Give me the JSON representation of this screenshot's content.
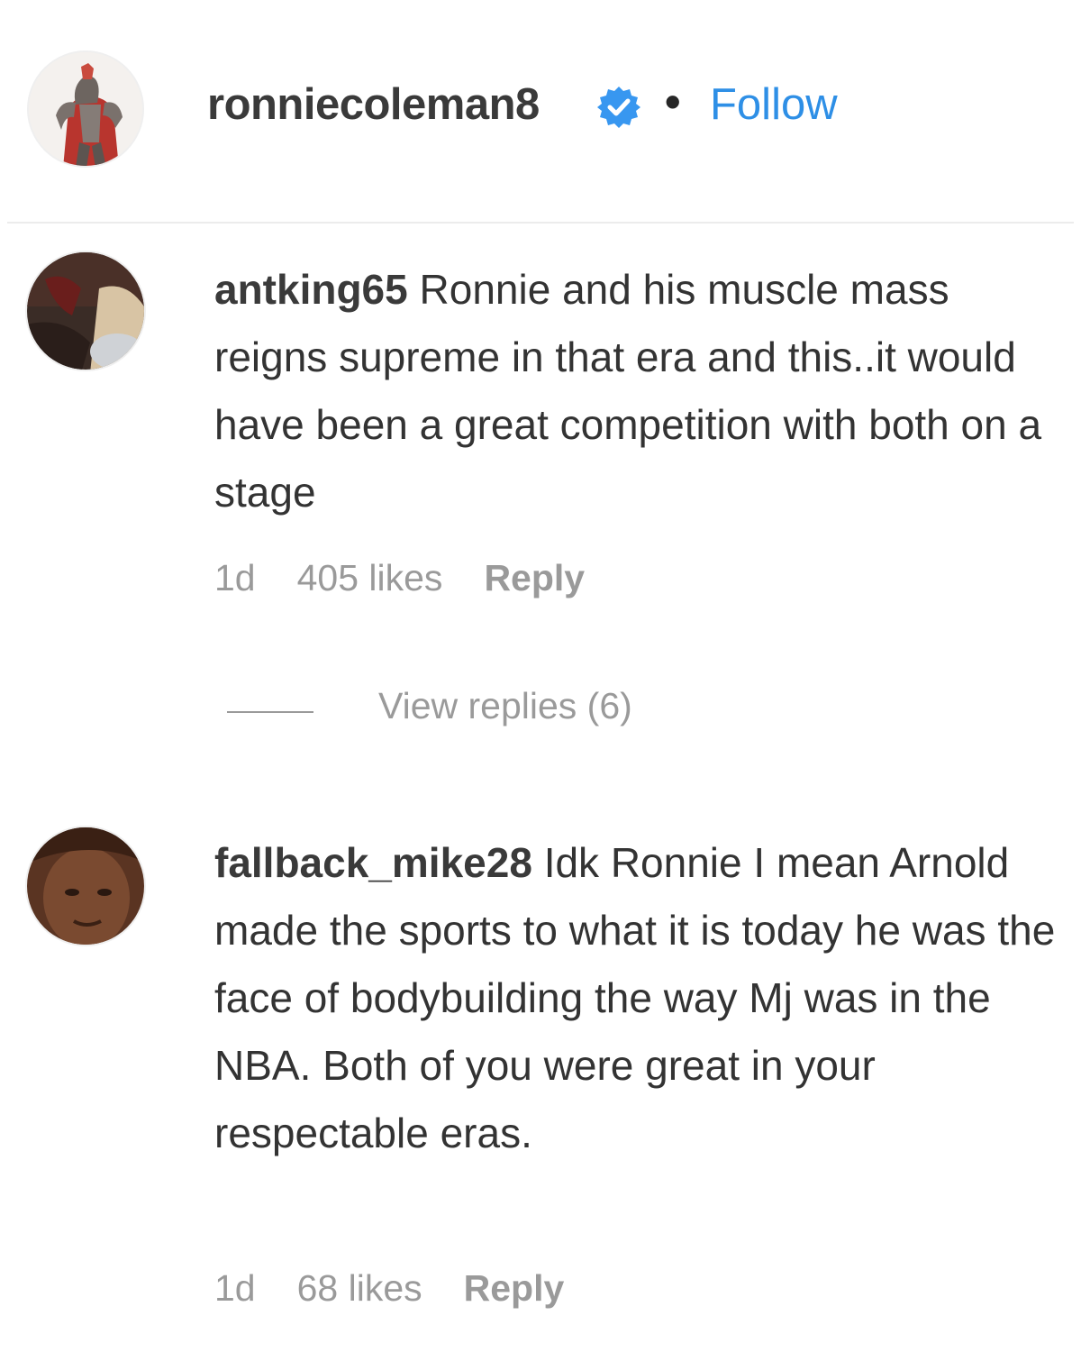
{
  "header": {
    "username": "ronniecoleman8",
    "verified_icon": "verified-badge-icon",
    "separator": "•",
    "follow_label": "Follow",
    "accent_color": "#2e8fe6"
  },
  "comments": [
    {
      "author": "antking65",
      "text": "Ronnie and his muscle mass reigns supreme in that era and this..it would have been a great competition with both on a stage",
      "time": "1d",
      "likes": "405 likes",
      "reply_label": "Reply",
      "view_replies": "View replies (6)"
    },
    {
      "author": "fallback_mike28",
      "text": "Idk Ronnie I mean Arnold made the sports to what it is today he was the face of bodybuilding the way Mj was in the NBA. Both of you were great in your respectable eras.",
      "time": "1d",
      "likes": "68 likes",
      "reply_label": "Reply"
    }
  ]
}
